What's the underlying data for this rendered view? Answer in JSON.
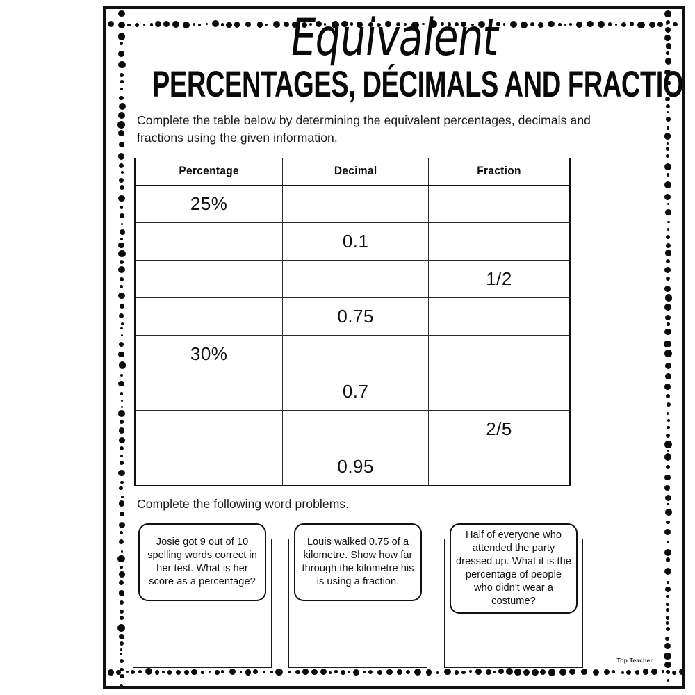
{
  "page": {
    "title_script": "Equivalent",
    "title_sub": "PERCENTAGES, DÉCIMALS AND FRACTIONS",
    "brand": "Top Teacher"
  },
  "instructions": {
    "table_task": "Complete the table below by determining the equivalent percentages, decimals and fractions using the given information.",
    "word_task": "Complete the following word problems."
  },
  "table": {
    "headers": [
      "Percentage",
      "Decimal",
      "Fraction"
    ],
    "rows": [
      {
        "percentage": "25%",
        "decimal": "",
        "fraction": ""
      },
      {
        "percentage": "",
        "decimal": "0.1",
        "fraction": ""
      },
      {
        "percentage": "",
        "decimal": "",
        "fraction": "1/2"
      },
      {
        "percentage": "",
        "decimal": "0.75",
        "fraction": ""
      },
      {
        "percentage": "30%",
        "decimal": "",
        "fraction": ""
      },
      {
        "percentage": "",
        "decimal": "0.7",
        "fraction": ""
      },
      {
        "percentage": "",
        "decimal": "",
        "fraction": "2/5"
      },
      {
        "percentage": "",
        "decimal": "0.95",
        "fraction": ""
      }
    ]
  },
  "word_problems": [
    {
      "text": "Josie got 9 out of 10 spelling words correct in her test. What is her score as a percentage?",
      "answer": ""
    },
    {
      "text": "Louis walked 0.75 of a kilometre. Show how far through the kilometre his is using a fraction.",
      "answer": ""
    },
    {
      "text": "Half of everyone who attended the party dressed up. What it is the percentage of people who didn't wear a costume?",
      "answer": ""
    }
  ],
  "colors": {
    "ink": "#111111",
    "paper": "#ffffff",
    "border": "#0c0c0c"
  }
}
